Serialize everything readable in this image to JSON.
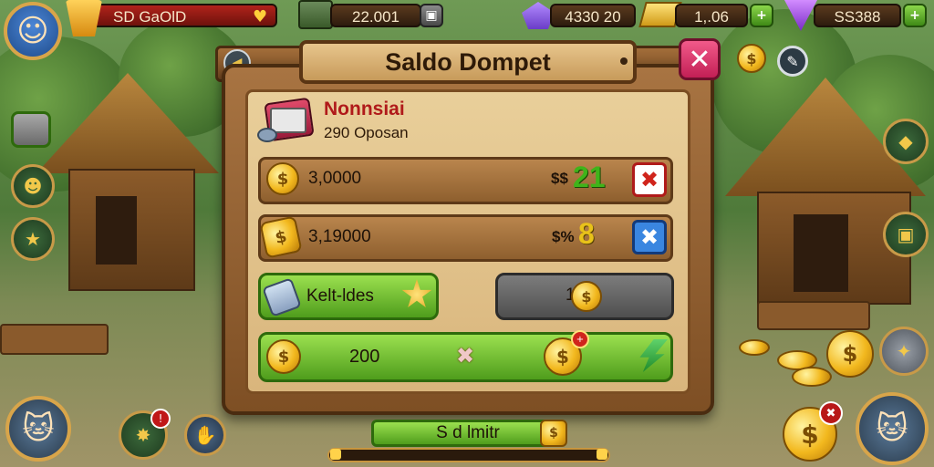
{
  "hud": {
    "gold_label": "SD GaOlD",
    "resources": [
      {
        "name": "books",
        "value": "22.001",
        "icon": "book-stack-icon"
      },
      {
        "name": "gems",
        "value": "4330 20",
        "icon": "purple-gem-icon"
      },
      {
        "name": "gold-bars",
        "value": "1,.06",
        "icon": "gold-bar-icon"
      },
      {
        "name": "crystals",
        "value": "SS388",
        "icon": "crystal-icon"
      }
    ]
  },
  "panel": {
    "title": "Saldo Dompet",
    "header_name": "Nonnsiai",
    "header_sub": "290 Oposan",
    "rows": [
      {
        "amount": "3,0000",
        "price_prefix": "$$",
        "price": "21"
      },
      {
        "amount": "3,19000",
        "price_prefix": "$%",
        "price": "8"
      }
    ],
    "buttons": {
      "green_label": "Kelt-ldes",
      "gray_label": "1",
      "confirm_amount": "200"
    }
  },
  "bottom": {
    "bar_label": "S d lmitr",
    "progress": 0.03
  },
  "colors": {
    "accent_green": "#4f9d1c",
    "close_pink": "#c21f55",
    "wood": "#8e5f2e",
    "coin_gold": "#f2b81e"
  }
}
